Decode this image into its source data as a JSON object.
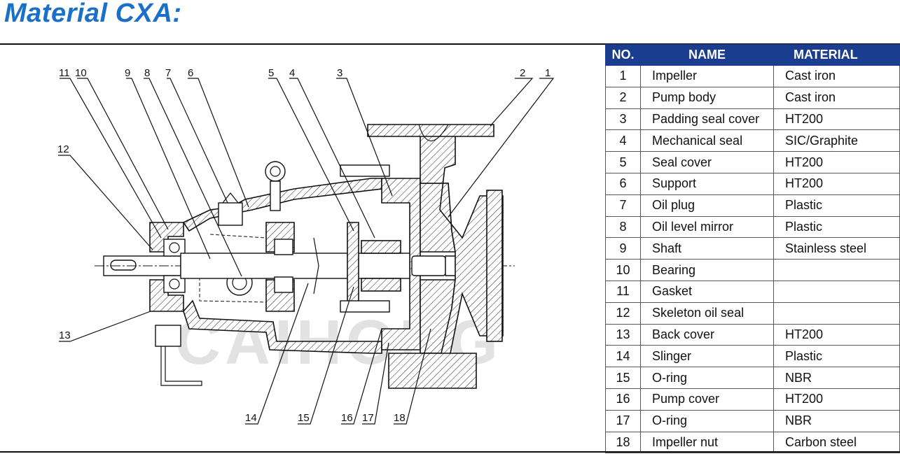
{
  "title": "Material CXA:",
  "table": {
    "headers": {
      "no": "NO.",
      "name": "NAME",
      "material": "MATERIAL"
    },
    "rows": [
      {
        "no": "1",
        "name": "Impeller",
        "material": "Cast iron"
      },
      {
        "no": "2",
        "name": "Pump body",
        "material": "Cast iron"
      },
      {
        "no": "3",
        "name": "Padding seal cover",
        "material": "HT200"
      },
      {
        "no": "4",
        "name": "Mechanical seal",
        "material": "SIC/Graphite"
      },
      {
        "no": "5",
        "name": "Seal cover",
        "material": "HT200"
      },
      {
        "no": "6",
        "name": "Support",
        "material": "HT200"
      },
      {
        "no": "7",
        "name": "Oil plug",
        "material": "Plastic"
      },
      {
        "no": "8",
        "name": "Oil level mirror",
        "material": "Plastic"
      },
      {
        "no": "9",
        "name": "Shaft",
        "material": "Stainless steel"
      },
      {
        "no": "10",
        "name": "Bearing",
        "material": ""
      },
      {
        "no": "11",
        "name": "Gasket",
        "material": ""
      },
      {
        "no": "12",
        "name": "Skeleton oil seal",
        "material": ""
      },
      {
        "no": "13",
        "name": "Back cover",
        "material": "HT200"
      },
      {
        "no": "14",
        "name": "Slinger",
        "material": "Plastic"
      },
      {
        "no": "15",
        "name": "O-ring",
        "material": "NBR"
      },
      {
        "no": "16",
        "name": "Pump cover",
        "material": "HT200"
      },
      {
        "no": "17",
        "name": "O-ring",
        "material": "NBR"
      },
      {
        "no": "18",
        "name": "Impeller nut",
        "material": "Carbon steel"
      }
    ]
  },
  "diagram": {
    "watermark": "CAIHONG",
    "callouts": [
      "1",
      "2",
      "3",
      "4",
      "5",
      "6",
      "7",
      "8",
      "9",
      "10",
      "11",
      "12",
      "13",
      "14",
      "15",
      "16",
      "17",
      "18"
    ]
  }
}
